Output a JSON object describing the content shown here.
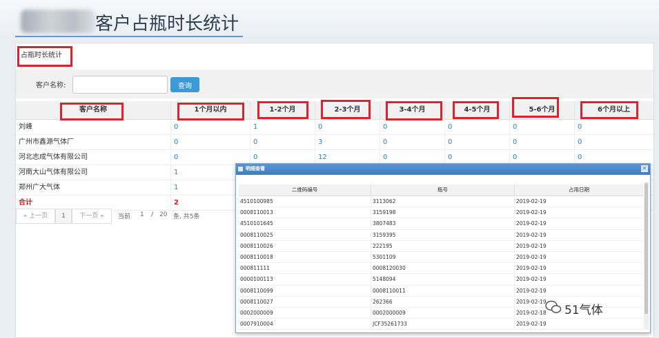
{
  "page": {
    "title": "客户占瓶时长统计"
  },
  "tab": {
    "label": "占瓶时长统计"
  },
  "search": {
    "label": "客户名称:",
    "value": "",
    "button": "查询"
  },
  "table": {
    "headers": [
      "客户名称",
      "1个月以内",
      "1-2个月",
      "2-3个月",
      "3-4个月",
      "4-5个月",
      "5-6个月",
      "6个月以上"
    ],
    "rows": [
      [
        "刘峰",
        "0",
        "1",
        "0",
        "0",
        "0",
        "0",
        "0"
      ],
      [
        "广州市鑫源气体厂",
        "0",
        "0",
        "3",
        "0",
        "0",
        "0",
        "0"
      ],
      [
        "河北志成气体有限公司",
        "0",
        "0",
        "12",
        "0",
        "0",
        "0",
        "0"
      ],
      [
        "河南大山气体有限公司",
        "1",
        "",
        "",
        "",
        "",
        "",
        ""
      ],
      [
        "郑州广大气体",
        "1",
        "",
        "",
        "",
        "",
        "",
        ""
      ]
    ],
    "total": {
      "label": "合计",
      "value": "2"
    }
  },
  "pager": {
    "prev": "« 上一页",
    "current": "1",
    "next": "下一页 »",
    "info_current": "当前",
    "page": "1",
    "slash": "/",
    "count": "20",
    "summary": "条, 共5条"
  },
  "popup": {
    "title": "明细查看",
    "close": "×",
    "headers": [
      "二维码编号",
      "瓶号",
      "占用日期"
    ],
    "rows": [
      [
        "4510100985",
        "3113062",
        "2019-02-19"
      ],
      [
        "0008110013",
        "3159198",
        "2019-02-19"
      ],
      [
        "4510101645",
        "3807483",
        "2019-02-19"
      ],
      [
        "0008110025",
        "3159395",
        "2019-02-19"
      ],
      [
        "0008110026",
        "222195",
        "2019-02-19"
      ],
      [
        "0008110018",
        "5301109",
        "2019-02-19"
      ],
      [
        "000811111",
        "0008120030",
        "2019-02-19"
      ],
      [
        "0000100113",
        "5148094",
        "2019-02-19"
      ],
      [
        "0008110099",
        "0008110011",
        "2019-02-19"
      ],
      [
        "0008110027",
        "262366",
        "2019-02-19"
      ],
      [
        "0002000009",
        "0002000009",
        "2019-02-18"
      ],
      [
        "0007910004",
        "JCF35261733",
        "2019-02-19"
      ]
    ]
  },
  "watermark": {
    "text": "51气体"
  },
  "colors": {
    "accent": "#3a9ad9",
    "highlight": "#e0202c",
    "link": "#2b7fc4",
    "total": "#d21c1c"
  }
}
